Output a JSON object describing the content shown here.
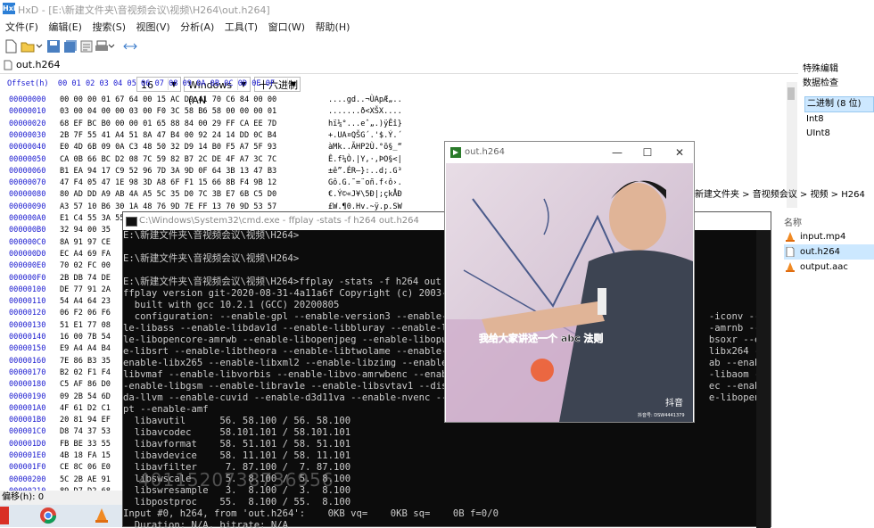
{
  "hxd": {
    "title": "HxD - [E:\\新建文件夹\\音视频会议\\视频\\H264\\out.h264]",
    "menu": [
      "文件(F)",
      "编辑(E)",
      "搜索(S)",
      "视图(V)",
      "分析(A)",
      "工具(T)",
      "窗口(W)",
      "帮助(H)"
    ],
    "toolbar": {
      "bytes_per_row": "16",
      "charset": "Windows (AN",
      "display_mode": "十六进制"
    },
    "tab": "out.h264",
    "hex_header": "Offset(h)  00 01 02 03 04 05 06 07 08 09 0A 0B 0C 0D 0E 0F",
    "rows": [
      {
        "off": "00000000",
        "bytes": "00 00 00 01 67 64 00 15 AC D9 41 70 C6 84 00 00",
        "txt": "....gd..¬ÙApÆ„.."
      },
      {
        "off": "00000010",
        "bytes": "03 00 04 00 00 03 00 F0 3C 58 B6 58 00 00 00 01",
        "txt": ".......ð<XŠX...."
      },
      {
        "off": "00000020",
        "bytes": "68 EF BC B0 00 00 01 65 88 84 00 29 FF CA EE 7D",
        "txt": "hï¼°...eˆ„.)ÿÊî}"
      },
      {
        "off": "00000030",
        "bytes": "2B 7F 55 41 A4 51 8A 47 B4 00 92 24 14 DD 0C B4",
        "txt": "+.UA¤QŠG´.'$.Ý.´"
      },
      {
        "off": "00000040",
        "bytes": "E0 4D 6B 09 0A C3 48 50 32 D9 14 B0 F5 A7 5F 93",
        "txt": "àMk..ÃHP2Ù.°õ§_“"
      },
      {
        "off": "00000050",
        "bytes": "CA 0B 66 BC D2 08 7C 59 82 B7 2C DE 4F A7 3C 7C",
        "txt": "Ê.f¼Ò.|Y‚·,ÞO§<|"
      },
      {
        "off": "00000060",
        "bB1 EA 94 17 C9 52 96 7D 3A 9D 0F 64 3B 13 47 B3": "",
        "bytes": "B1 EA 94 17 C9 52 96 7D 3A 9D 0F 64 3B 13 47 B3",
        "txt": "±ê”.ÉR–}:..d;.G³"
      },
      {
        "off": "00000070",
        "bytes": "47 F4 05 47 1E 98 3D A8 6F F1 15 66 8B F4 9B 12",
        "txt": "Gô.G.˜=¨oñ.f‹ô›."
      },
      {
        "off": "00000080",
        "bytes": "80 AD DD A9 AB 4A A5 5C 35 D0 7C 3B E7 6B C5 D0",
        "txt": "€.Ý©«J¥\\5Ð|;çkÅÐ"
      },
      {
        "off": "00000090",
        "bytes": "A3 57 10 B6 30 1A 48 76 9D 7E FF 13 70 9D 53 57",
        "txt": "£W.¶0.Hv.~ÿ.p.SW"
      },
      {
        "off": "000000A0",
        "bytes": "E1 C4 55 3A 55 ED BF 0D 32 5A E6 49 1B 7A 95 D7",
        "txt": "áÄU:Uí¿.2ZæI.z•×"
      },
      {
        "off": "000000B0",
        "bytes": "32 94 00 35",
        "txt": ""
      },
      {
        "off": "000000C0",
        "bytes": "8A 91 97 CE",
        "txt": ""
      },
      {
        "off": "000000D0",
        "bytes": "EC A4 69 FA",
        "txt": ""
      },
      {
        "off": "000000E0",
        "bytes": "70 02 FC 00",
        "txt": ""
      },
      {
        "off": "000000F0",
        "bytes": "2B DB 74 DE",
        "txt": ""
      },
      {
        "off": "00000100",
        "bytes": "DE 77 91 2A",
        "txt": ""
      },
      {
        "off": "00000110",
        "bytes": "54 A4 64 23",
        "txt": ""
      },
      {
        "off": "00000120",
        "bytes": "06 F2 06 F6",
        "txt": ""
      },
      {
        "off": "00000130",
        "bytes": "51 E1 77 08",
        "txt": ""
      },
      {
        "off": "00000140",
        "bytes": "16 00 7B 54",
        "txt": ""
      },
      {
        "off": "00000150",
        "bytes": "E9 A4 A4 B4",
        "txt": ""
      },
      {
        "off": "00000160",
        "bytes": "7E 86 B3 35",
        "txt": ""
      },
      {
        "off": "00000170",
        "bytes": "B2 02 F1 F4",
        "txt": ""
      },
      {
        "off": "00000180",
        "bytes": "C5 AF 86 D0",
        "txt": ""
      },
      {
        "off": "00000190",
        "bytes": "09 2B 54 6D",
        "txt": ""
      },
      {
        "off": "000001A0",
        "bytes": "4F 61 D2 C1",
        "txt": ""
      },
      {
        "off": "000001B0",
        "bytes": "20 81 94 EF",
        "txt": ""
      },
      {
        "off": "000001C0",
        "bytes": "D8 74 37 53",
        "txt": ""
      },
      {
        "off": "000001D0",
        "bytes": "FB BE 33 55",
        "txt": ""
      },
      {
        "off": "000001E0",
        "bytes": "4B 18 FA 15",
        "txt": ""
      },
      {
        "off": "000001F0",
        "bytes": "CE 8C 06 E0",
        "txt": ""
      },
      {
        "off": "00000200",
        "bytes": "5C 2B AE 91",
        "txt": ""
      },
      {
        "off": "00000210",
        "bytes": "89 D7 D2 68",
        "txt": ""
      },
      {
        "off": "00000220",
        "bytes": "60 BC ED FE",
        "txt": ""
      },
      {
        "off": "00000230",
        "bytes": "55 A3 BB FD",
        "txt": ""
      }
    ],
    "right_pane": {
      "title": "特殊编辑",
      "subtitle": "数据检查",
      "items": [
        "二进制 (8 位)",
        "Int8",
        "UInt8"
      ]
    },
    "status": "偏移(h): 0"
  },
  "explorer": {
    "breadcrumb": "新建文件夹  >  音视频会议  >  视频  >  H264",
    "column": "名称",
    "files": [
      "input.mp4",
      "out.h264",
      "output.aac"
    ]
  },
  "video": {
    "title": "out.h264",
    "subtitle_text": "我给大家讲述一个 abc 法则",
    "brand": "抖音",
    "id": "抖音号: DSW4441379"
  },
  "cmd": {
    "title": "C:\\Windows\\System32\\cmd.exe - ffplay  -stats -f h264 out.h264",
    "lines": [
      "E:\\新建文件夹\\音视频会议\\视频\\H264>",
      "",
      "E:\\新建文件夹\\音视频会议\\视频\\H264>",
      "",
      "E:\\新建文件夹\\音视频会议\\视频\\H264>ffplay -stats -f h264 out",
      "ffplay version git-2020-08-31-4a11a6f Copyright (c) 2003-202",
      "  built with gcc 10.2.1 (GCC) 20200805",
      "  configuration: --enable-gpl --enable-version3 --enable-sdl                                           -iconv --enabl",
      "le-libass --enable-libdav1d --enable-libbluray --enable-libfr                                          -amrnb --enabl",
      "le-libopencore-amrwb --enable-libopenjpeg --enable-libopus --                                          bsoxr --enabl",
      "e-libsrt --enable-libtheora --enable-libtwolame --enable-lib                                           libx264 --",
      "enable-libx265 --enable-libxml2 --enable-libzimg --enable-lz                                           ab --enable-",
      "libvmaf --enable-libvorbis --enable-libvo-amrwbenc --enable-l                                          -libaom --",
      "-enable-libgsm --enable-librav1e --enable-libsvtav1 --disab                                            ec --enable-cu",
      "da-llvm --enable-cuvid --enable-d3d11va --enable-nvenc --ena                                           e-libopenm",
      "pt --enable-amf",
      "  libavutil      56. 58.100 / 56. 58.100",
      "  libavcodec     58.101.101 / 58.101.101",
      "  libavformat    58. 51.101 / 58. 51.101",
      "  libavdevice    58. 11.101 / 58. 11.101",
      "  libavfilter     7. 87.100 /  7. 87.100",
      "  libswscale      5.  8.100 /  5.  8.100",
      "  libswresample   3.  8.100 /  3.  8.100",
      "  libpostproc    55.  8.100 / 55.  8.100",
      "Input #0, h264, from 'out.h264':    0KB vq=    0KB sq=    0B f=0/0",
      "  Duration: N/A, bitrate: N/A"
    ]
  },
  "watermark": "4011520738736956"
}
